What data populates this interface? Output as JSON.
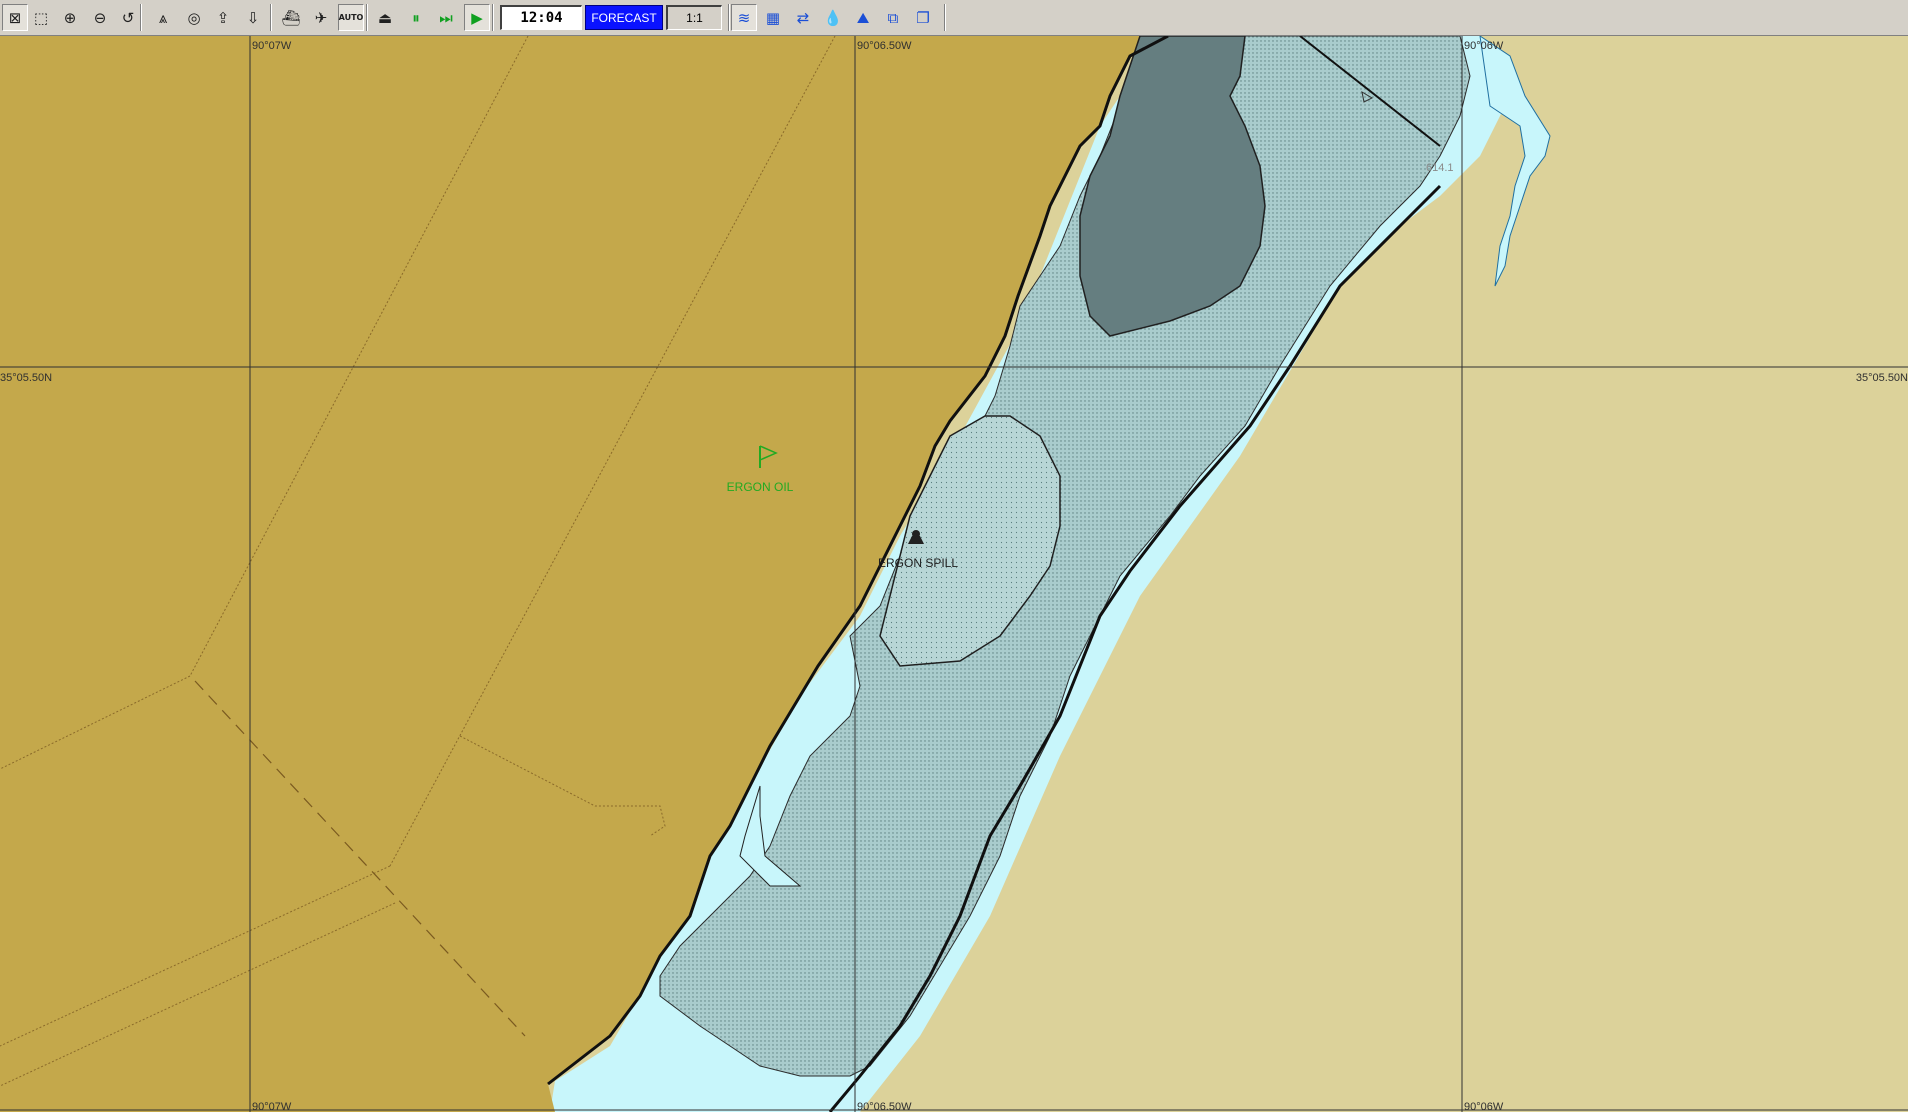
{
  "toolbar": {
    "tools": [
      {
        "name": "pan-tool-icon",
        "glyph": "⊠"
      },
      {
        "name": "select-tool-icon",
        "glyph": "⬚"
      },
      {
        "name": "zoom-in-icon",
        "glyph": "⊕"
      },
      {
        "name": "zoom-out-icon",
        "glyph": "⊖"
      },
      {
        "name": "undo-icon",
        "glyph": "↺"
      },
      {
        "name": "draw-tool-icon",
        "glyph": "⩓"
      },
      {
        "name": "target-icon",
        "glyph": "◎"
      },
      {
        "name": "export-icon",
        "glyph": "⇪"
      },
      {
        "name": "import-icon",
        "glyph": "⇩"
      },
      {
        "name": "vessel-icon",
        "glyph": "⛴"
      },
      {
        "name": "aircraft-icon",
        "glyph": "✈"
      },
      {
        "name": "auto-icon",
        "glyph": "AUTO"
      },
      {
        "name": "stop-icon",
        "glyph": "⏏"
      },
      {
        "name": "pause-icon",
        "glyph": "⏸"
      },
      {
        "name": "fast-forward-icon",
        "glyph": "⏭"
      },
      {
        "name": "play-icon",
        "glyph": "▶"
      }
    ],
    "time": "12:04",
    "forecast_label": "FORECAST",
    "scale": "1:1",
    "right_tools": [
      {
        "name": "wind-icon",
        "glyph": "≋"
      },
      {
        "name": "grid-icon",
        "glyph": "▦"
      },
      {
        "name": "currents-icon",
        "glyph": "⇄"
      },
      {
        "name": "droplets-icon",
        "glyph": "💧"
      },
      {
        "name": "shoreline-icon",
        "glyph": "⛰"
      },
      {
        "name": "copy-icon",
        "glyph": "⧉"
      },
      {
        "name": "windows-icon",
        "glyph": "❐"
      }
    ]
  },
  "map": {
    "colors": {
      "land_dark": "#c4a84b",
      "land_light": "#dcd29a",
      "water": "#c8f6fb",
      "slick": "#a8c8c8",
      "heavy_oil": "#657e80",
      "grid": "#303030",
      "label_green": "#22aa22"
    },
    "grid_labels": {
      "top_lon_1": "90°07W",
      "top_lon_2": "90°06.50W",
      "top_lon_3": "90°06W",
      "bottom_lon_1": "90°07W",
      "bottom_lon_2": "90°06.50W",
      "bottom_lon_3": "90°06W",
      "left_lat": "35°05.50N",
      "right_lat": "35°05.50N"
    },
    "flag_label": "ERGON OIL",
    "spill_label": "ERGON SPILL",
    "marker_label": "614.1"
  }
}
